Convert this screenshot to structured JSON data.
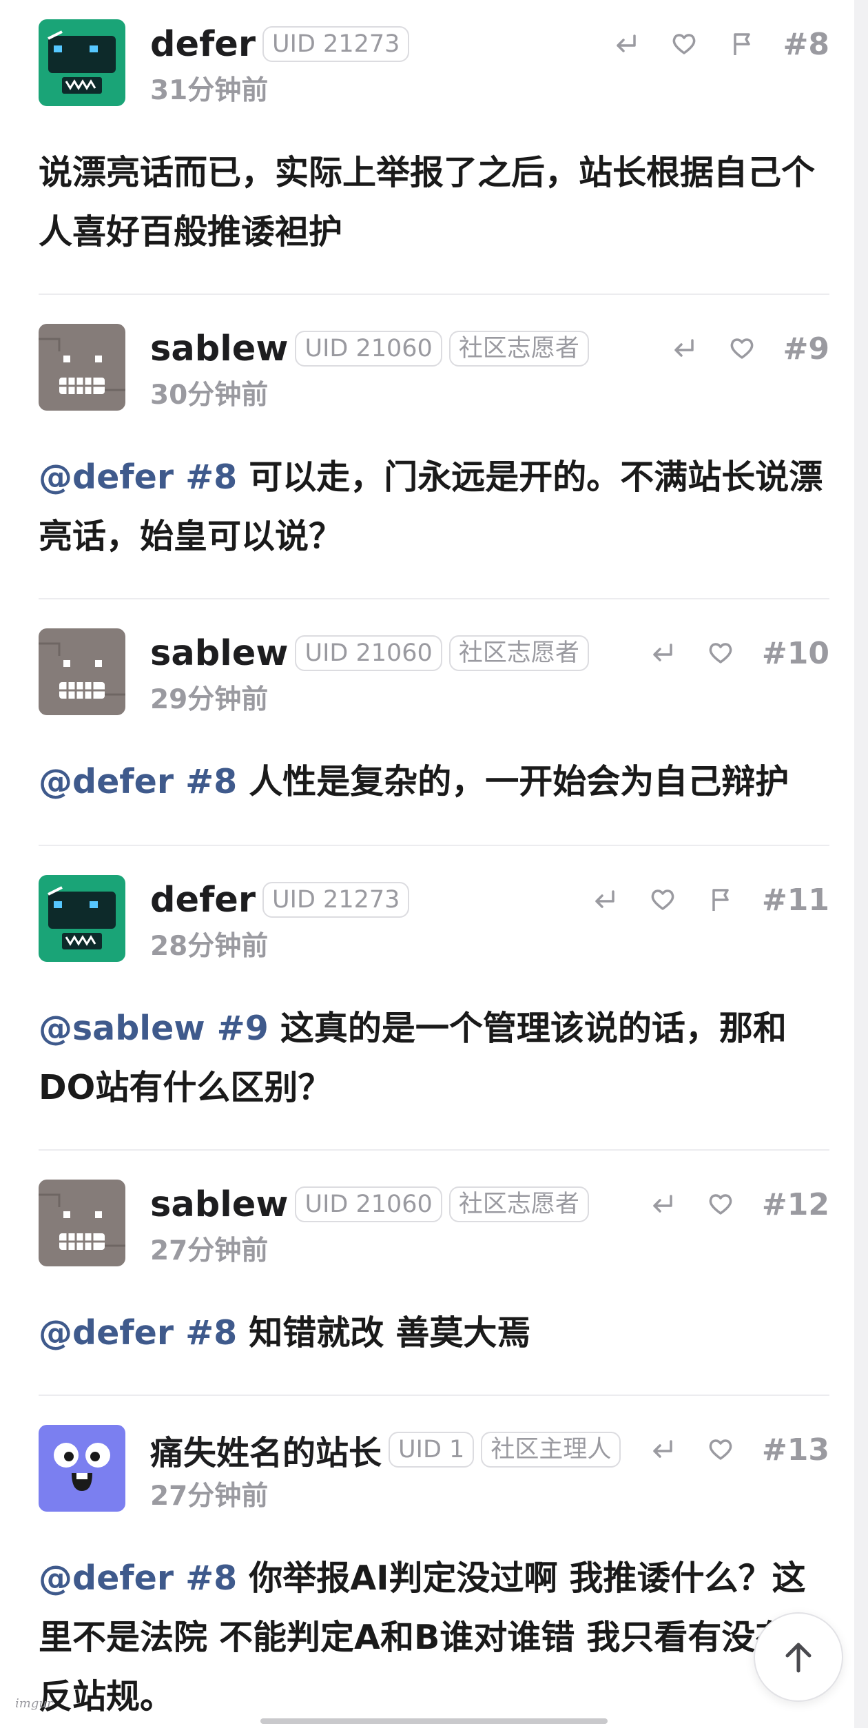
{
  "posts": [
    {
      "name": "defer",
      "uid": "UID 21273",
      "role": "",
      "time": "31分钟前",
      "num": "#8",
      "mention": "",
      "body": "说漂亮话而已，实际上举报了之后，站长根据自己个人喜好百般推诿袒护",
      "avatar": "green",
      "flag": true
    },
    {
      "name": "sablew",
      "uid": "UID 21060",
      "role": "社区志愿者",
      "time": "30分钟前",
      "num": "#9",
      "mention": "@defer #8",
      "body": " 可以走，门永远是开的。不满站长说漂亮话，始皇可以说？",
      "avatar": "gray",
      "flag": false
    },
    {
      "name": "sablew",
      "uid": "UID 21060",
      "role": "社区志愿者",
      "time": "29分钟前",
      "num": "#10",
      "mention": "@defer #8",
      "body": " 人性是复杂的，一开始会为自己辩护",
      "avatar": "gray",
      "flag": false
    },
    {
      "name": "defer",
      "uid": "UID 21273",
      "role": "",
      "time": "28分钟前",
      "num": "#11",
      "mention": "@sablew #9",
      "body": " 这真的是一个管理该说的话，那和DO站有什么区别？",
      "avatar": "green",
      "flag": true
    },
    {
      "name": "sablew",
      "uid": "UID 21060",
      "role": "社区志愿者",
      "time": "27分钟前",
      "num": "#12",
      "mention": "@defer #8",
      "body": " 知错就改 善莫大焉",
      "avatar": "gray",
      "flag": false
    },
    {
      "name": "痛失姓名的站长",
      "uid": "UID 1",
      "role": "社区主理人",
      "time": "27分钟前",
      "num": "#13",
      "mention": "@defer #8",
      "body": " 你举报AI判定没过啊 我推诿什么？这里不是法院 不能判定A和B谁对谁错 我只看有没有违反站规。",
      "avatar": "purple",
      "flag": false
    }
  ],
  "watermark": "imgur",
  "icons": {
    "reply": "reply-icon",
    "like": "heart-icon",
    "report": "flag-icon",
    "top": "arrow-up-icon"
  },
  "colors": {
    "mention": "#3f5a8c",
    "muted": "#9a9aa0",
    "green_avatar": "#1aa477",
    "gray_avatar": "#857c79",
    "purple_avatar": "#7b7ff0"
  }
}
